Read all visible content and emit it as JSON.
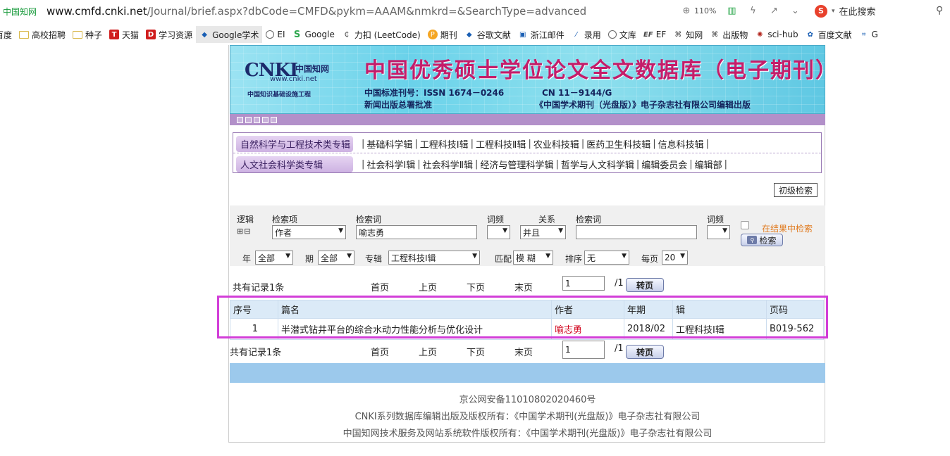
{
  "browser": {
    "site_label": "中国知网",
    "url_host": "www.cmfd.cnki.net",
    "url_path": "/Journal/brief.aspx?dbCode=CMFD&pykm=AAAM&nmkrd=&SearchType=advanced",
    "zoom": "110%",
    "search_placeholder": "在此搜索"
  },
  "bookmarks": [
    {
      "label": "百度",
      "icon": "baidu-icon"
    },
    {
      "label": "高校招聘",
      "icon": "folder-icon"
    },
    {
      "label": "种子",
      "icon": "folder-icon"
    },
    {
      "label": "天猫",
      "icon": "tmall-icon"
    },
    {
      "label": "学习资源",
      "icon": "d-icon"
    },
    {
      "label": "Google学术",
      "icon": "scholar-icon"
    },
    {
      "label": "EI",
      "icon": "globe-icon"
    },
    {
      "label": "Google",
      "icon": "s-icon"
    },
    {
      "label": "力扣 (LeetCode)",
      "icon": "leetcode-icon"
    },
    {
      "label": "期刊",
      "icon": "p-icon"
    },
    {
      "label": "谷歌文献",
      "icon": "scholar-icon"
    },
    {
      "label": "浙江邮件",
      "icon": "mail-icon"
    },
    {
      "label": "录用",
      "icon": "chart-icon"
    },
    {
      "label": "文库",
      "icon": "globe-icon"
    },
    {
      "label": "EF",
      "icon": "ef-icon"
    },
    {
      "label": "知网",
      "icon": "cnki-icon"
    },
    {
      "label": "出版物",
      "icon": "cnki-icon"
    },
    {
      "label": "sci-hub",
      "icon": "scihub-icon"
    },
    {
      "label": "百度文献",
      "icon": "paw-icon"
    },
    {
      "label": "G",
      "icon": "translate-icon"
    }
  ],
  "banner": {
    "logo_text": "CNKI",
    "logo_cn": "中国知网",
    "logo_url": "www.cnki.net",
    "logo_sub": "中国知识基础设施工程",
    "title": "中国优秀硕士学位论文全文数据库（电子期刊）",
    "issn": "中国标准刊号：ISSN 1674－0246",
    "cn": "CN 11－9144/G",
    "approve": "新闻出版总署批准",
    "publisher": "《中国学术期刊（光盘版）》电子杂志社有限公司编辑出版"
  },
  "nav": {
    "row1_category": "自然科学与工程技术类专辑",
    "row1_items": [
      "基础科学辑",
      "工程科技Ⅰ辑",
      "工程科技Ⅱ辑",
      "农业科技辑",
      "医药卫生科技辑",
      "信息科技辑"
    ],
    "row2_category": "人文社会科学类专辑",
    "row2_items": [
      "社会科学Ⅰ辑",
      "社会科学Ⅱ辑",
      "经济与管理科学辑",
      "哲学与人文科学辑",
      "编辑委员会",
      "编辑部"
    ]
  },
  "basic_search_label": "初级检索",
  "search": {
    "logic_label": "逻辑",
    "field_label": "检索项",
    "term_label": "检索词",
    "freq_label": "词频",
    "relation_label": "关系",
    "term2_label": "检索词",
    "freq2_label": "词频",
    "field_value": "作者",
    "term_value": "喻志勇",
    "freq_value": "",
    "relation_value": "并且",
    "term2_value": "",
    "freq2_value": "",
    "refine_label": "在结果中检索",
    "search_button": "检索",
    "year_label": "年",
    "year_value": "全部",
    "issue_label": "期",
    "issue_value": "全部",
    "album_label": "专辑",
    "album_value": "工程科技Ⅰ辑",
    "match_label": "匹配",
    "match_value": "模 糊",
    "sort_label": "排序",
    "sort_value": "无",
    "perpage_label": "每页",
    "perpage_value": "20"
  },
  "pager": {
    "total": "共有记录1条",
    "first": "首页",
    "prev": "上页",
    "next": "下页",
    "last": "末页",
    "page_value": "1",
    "page_total": "/1",
    "goto": "转页"
  },
  "table": {
    "headers": [
      "序号",
      "篇名",
      "作者",
      "年期",
      "辑",
      "页码"
    ],
    "rows": [
      [
        "1",
        "半潜式钻井平台的综合水动力性能分析与优化设计",
        "喻志勇",
        "2018/02",
        "工程科技Ⅰ辑",
        "B019-562"
      ]
    ]
  },
  "footer": {
    "line1": "京公网安备11010802020460号",
    "line2": "CNKI系列数据库编辑出版及版权所有：《中国学术期刊(光盘版)》电子杂志社有限公司",
    "line3": "中国知网技术服务及网站系统软件版权所有：《中国学术期刊(光盘版)》电子杂志社有限公司"
  },
  "colors": {
    "highlight_border": "#d23ed8",
    "author_link": "#d0021b",
    "banner_title": "#c41d6a"
  }
}
